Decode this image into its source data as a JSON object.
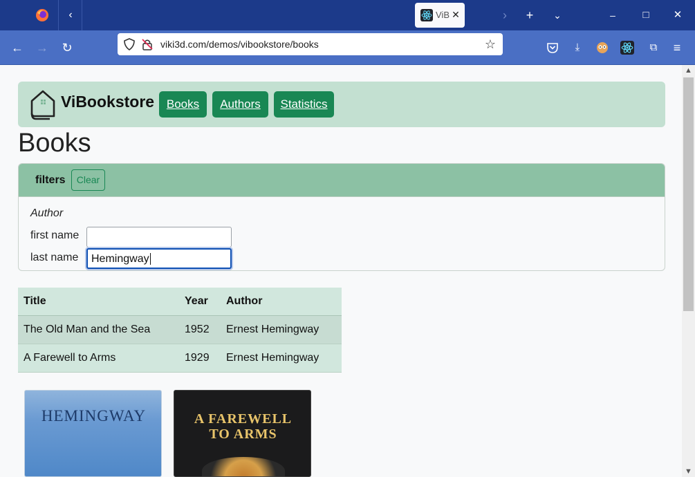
{
  "browser": {
    "tab_title": "ViBo",
    "url": "viki3d.com/demos/vibookstore/books",
    "icons": {
      "firefox": "firefox-icon",
      "tab_list": "chevron-left-icon",
      "new_tab": "plus-icon",
      "more_tabs": "chevron-down-icon",
      "back": "arrow-left-icon",
      "forward": "arrow-right-icon",
      "reload": "reload-icon",
      "star": "star-icon"
    },
    "window_controls": {
      "minimize": "–",
      "maximize": "□",
      "close": "✕"
    }
  },
  "app": {
    "brand": "ViBookstore",
    "nav": [
      {
        "label": "Books"
      },
      {
        "label": "Authors"
      },
      {
        "label": "Statistics"
      }
    ],
    "accent_color": "#198754",
    "header_bg": "#c3e0d1"
  },
  "page": {
    "title": "Books",
    "filters": {
      "title": "filters",
      "clear_label": "Clear",
      "author_label": "Author",
      "first_name_label": "first name",
      "first_name_value": "",
      "last_name_label": "last name",
      "last_name_value": "Hemingway"
    },
    "table": {
      "columns": [
        "Title",
        "Year",
        "Author"
      ],
      "rows": [
        [
          "The Old Man and the Sea",
          "1952",
          "Ernest Hemingway"
        ],
        [
          "A Farewell to Arms",
          "1929",
          "Ernest Hemingway"
        ]
      ]
    },
    "covers": [
      {
        "line1": "HEMINGWAY"
      },
      {
        "line1": "A FAREWELL",
        "line2": "TO ARMS"
      }
    ]
  }
}
